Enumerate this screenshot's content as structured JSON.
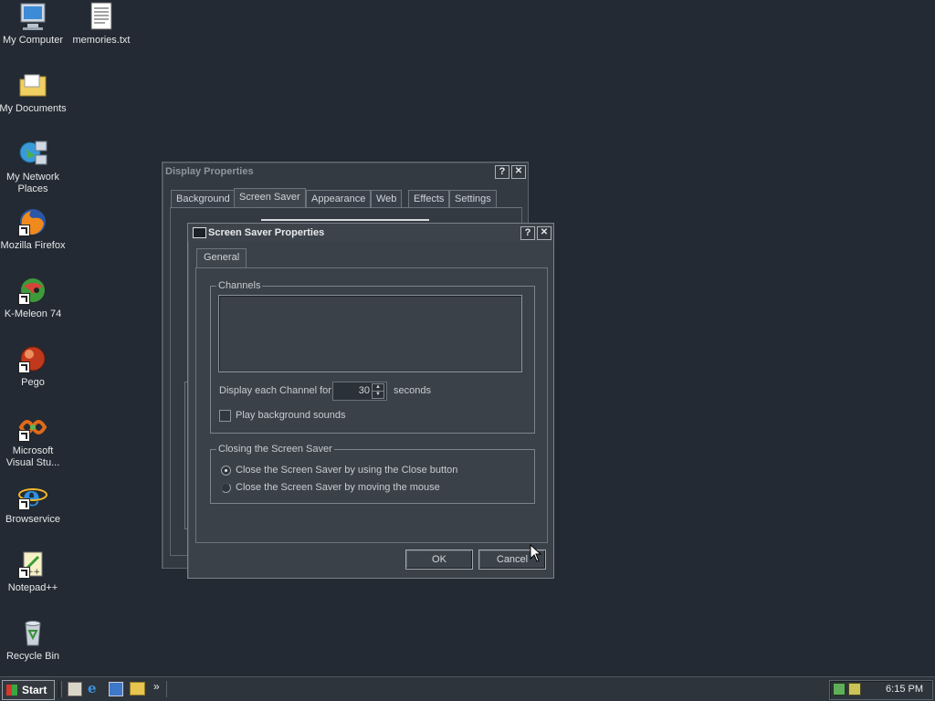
{
  "desktop_icons": [
    {
      "label": "My Computer",
      "icon": "my-computer-icon"
    },
    {
      "label": "memories.txt",
      "icon": "text-file-icon"
    },
    {
      "label": "My Documents",
      "icon": "folder-icon"
    },
    {
      "label": "My Network Places",
      "icon": "network-places-icon"
    },
    {
      "label": "Mozilla Firefox",
      "icon": "firefox-icon"
    },
    {
      "label": "K-Meleon 74",
      "icon": "k-meleon-icon"
    },
    {
      "label": "Pego",
      "icon": "pego-icon"
    },
    {
      "label": "Microsoft Visual Stu...",
      "icon": "visual-studio-icon"
    },
    {
      "label": "Browservice",
      "icon": "internet-explorer-icon"
    },
    {
      "label": "Notepad++",
      "icon": "notepad-plus-plus-icon"
    },
    {
      "label": "Recycle Bin",
      "icon": "recycle-bin-icon"
    }
  ],
  "display_properties": {
    "title": "Display Properties",
    "help": "?",
    "close": "✕",
    "tabs": [
      "Background",
      "Screen Saver",
      "Appearance",
      "Web",
      "Effects",
      "Settings"
    ]
  },
  "screensaver_dialog": {
    "title": "Screen Saver Properties",
    "help": "?",
    "close": "✕",
    "tab": "General",
    "channels_legend": "Channels",
    "display_each_label": "Display each Channel for",
    "display_each_value": "30",
    "seconds_label": "seconds",
    "play_sounds_label": "Play background sounds",
    "closing_legend": "Closing the Screen Saver",
    "radio_close_button": "Close the Screen Saver by using the Close button",
    "radio_move_mouse": "Close the Screen Saver by moving the mouse",
    "ok": "OK",
    "cancel": "Cancel"
  },
  "taskbar": {
    "start": "Start",
    "clock": "6:15 PM",
    "chevron": "»"
  },
  "colors": {
    "desktop": "#232a33",
    "window": "#3a4148",
    "text": "#c8ccd2"
  }
}
